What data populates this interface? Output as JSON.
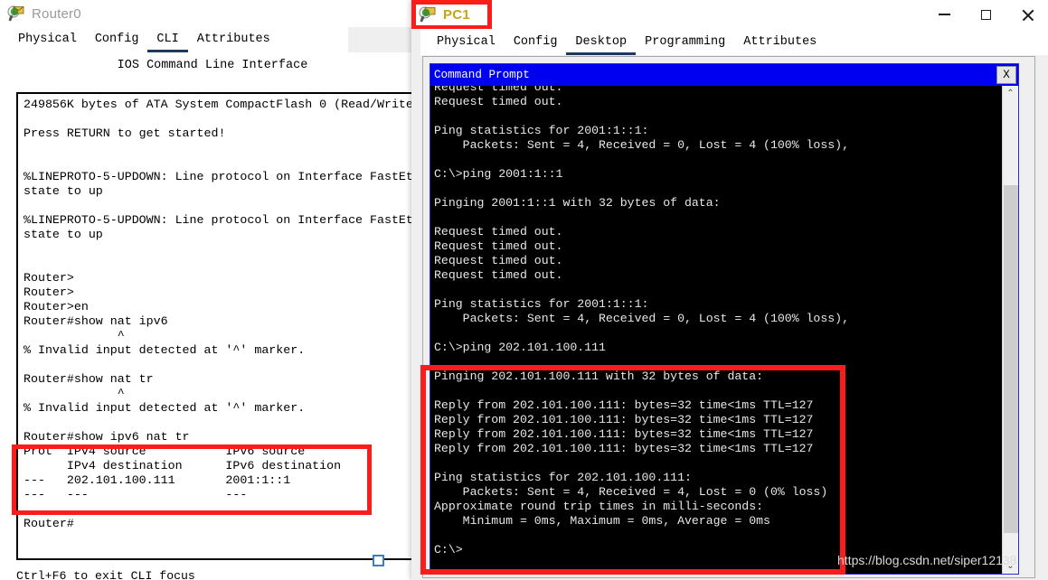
{
  "router_window": {
    "title": "Router0",
    "icon": "router-device-icon",
    "tabs": [
      {
        "label": "Physical",
        "selected": false
      },
      {
        "label": "Config",
        "selected": false
      },
      {
        "label": "CLI",
        "selected": true
      },
      {
        "label": "Attributes",
        "selected": false
      }
    ],
    "panel_header": "IOS Command Line Interface",
    "terminal_text": "249856K bytes of ATA System CompactFlash 0 (Read/Write\n\nPress RETURN to get started!\n\n\n%LINEPROTO-5-UPDOWN: Line protocol on Interface FastEt\nstate to up\n\n%LINEPROTO-5-UPDOWN: Line protocol on Interface FastEt\nstate to up\n\n\nRouter>\nRouter>\nRouter>en\nRouter#show nat ipv6\n             ^\n% Invalid input detected at '^' marker.\n\nRouter#show nat tr\n             ^\n% Invalid input detected at '^' marker.\n\nRouter#show ipv6 nat tr\nProt  IPv4 source           IPv6 source\n      IPv4 destination      IPv6 destination\n---   202.101.100.111       2001:1::1\n---   ---                   ---\n\nRouter#",
    "focus_hint": "Ctrl+F6 to exit CLI focus",
    "annotation_color": "#fb1c1c"
  },
  "pc1_window": {
    "title": "PC1",
    "icon": "pc-device-icon",
    "window_controls": [
      {
        "name": "minimize",
        "label": "—"
      },
      {
        "name": "maximize",
        "label": "□"
      },
      {
        "name": "close",
        "label": "✕"
      }
    ],
    "tabs": [
      {
        "label": "Physical",
        "selected": false
      },
      {
        "label": "Config",
        "selected": false
      },
      {
        "label": "Desktop",
        "selected": true
      },
      {
        "label": "Programming",
        "selected": false
      },
      {
        "label": "Attributes",
        "selected": false
      }
    ],
    "command_prompt": {
      "title": "Command Prompt",
      "close_label": "X",
      "terminal_text": "Request timed out.\nRequest timed out.\n\nPing statistics for 2001:1::1:\n    Packets: Sent = 4, Received = 0, Lost = 4 (100% loss),\n\nC:\\>ping 2001:1::1\n\nPinging 2001:1::1 with 32 bytes of data:\n\nRequest timed out.\nRequest timed out.\nRequest timed out.\nRequest timed out.\n\nPing statistics for 2001:1::1:\n    Packets: Sent = 4, Received = 0, Lost = 4 (100% loss),\n\nC:\\>ping 202.101.100.111\n\nPinging 202.101.100.111 with 32 bytes of data:\n\nReply from 202.101.100.111: bytes=32 time<1ms TTL=127\nReply from 202.101.100.111: bytes=32 time<1ms TTL=127\nReply from 202.101.100.111: bytes=32 time<1ms TTL=127\nReply from 202.101.100.111: bytes=32 time<1ms TTL=127\n\nPing statistics for 202.101.100.111:\n    Packets: Sent = 4, Received = 4, Lost = 0 (0% loss)\nApproximate round trip times in milli-seconds:\n    Minimum = 0ms, Maximum = 0ms, Average = 0ms\n\nC:\\>",
      "scrollbar": {
        "up_arrow": "⌃",
        "down_arrow": "⌄"
      }
    },
    "annotation_color": "#fb1c1c"
  },
  "watermark": "https://blog.csdn.net/siper12138"
}
